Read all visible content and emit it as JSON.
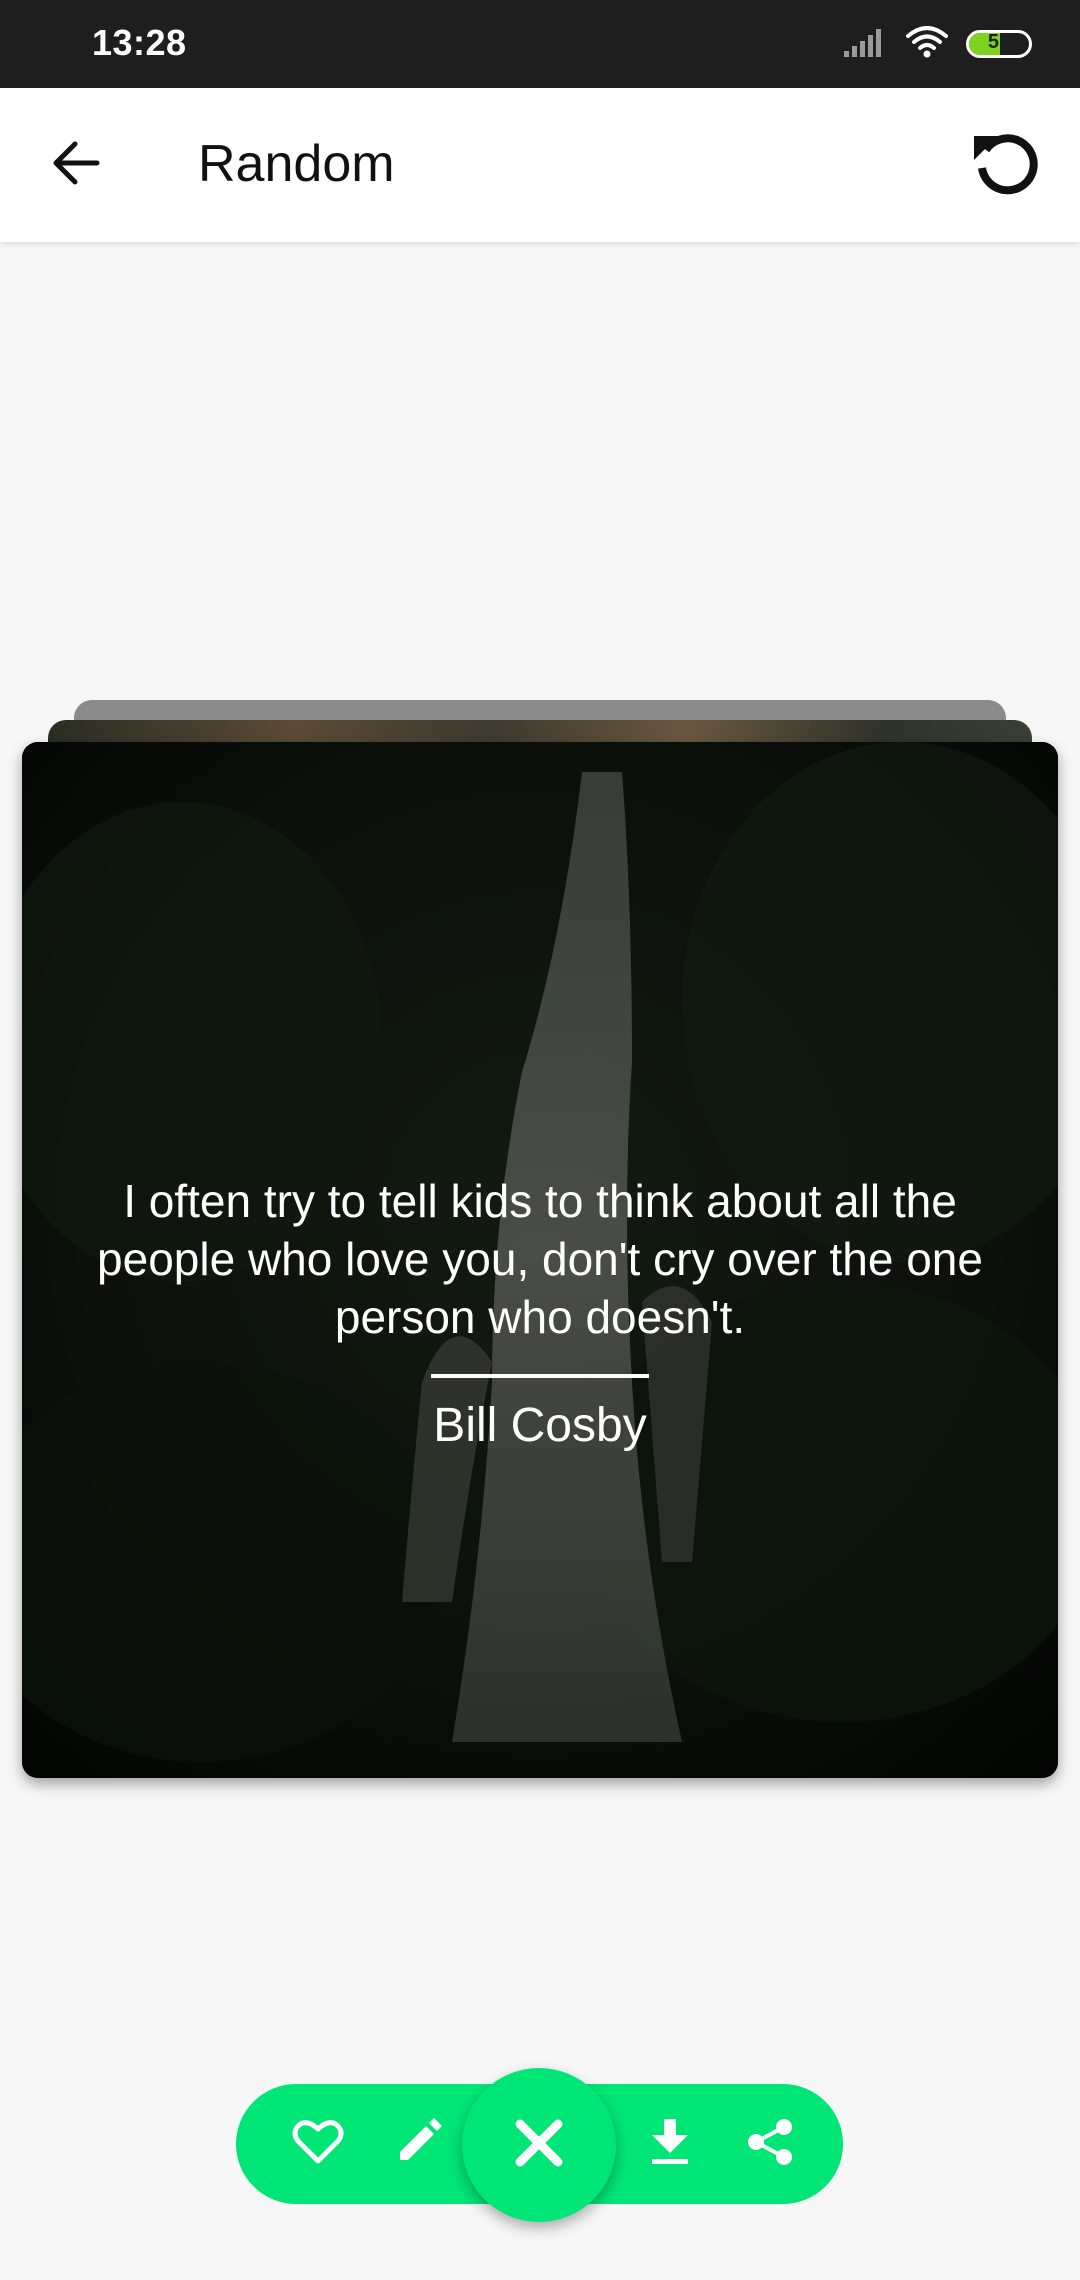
{
  "status_bar": {
    "time": "13:28",
    "battery_level": "51",
    "battery_fraction": 0.51,
    "icons": [
      "signal-icon",
      "wifi-icon",
      "battery-icon"
    ]
  },
  "app_bar": {
    "title": "Random",
    "back_icon": "arrow-back-icon",
    "refresh_icon": "refresh-icon"
  },
  "quote_card": {
    "text": "I often try to tell kids to think about all the people who love you, don't cry over the one person who doesn't.",
    "author": "Bill Cosby"
  },
  "actions": {
    "items": [
      "heart-icon",
      "edit-icon",
      "close-icon",
      "download-icon",
      "share-icon"
    ],
    "accent_color": "#00e676"
  }
}
